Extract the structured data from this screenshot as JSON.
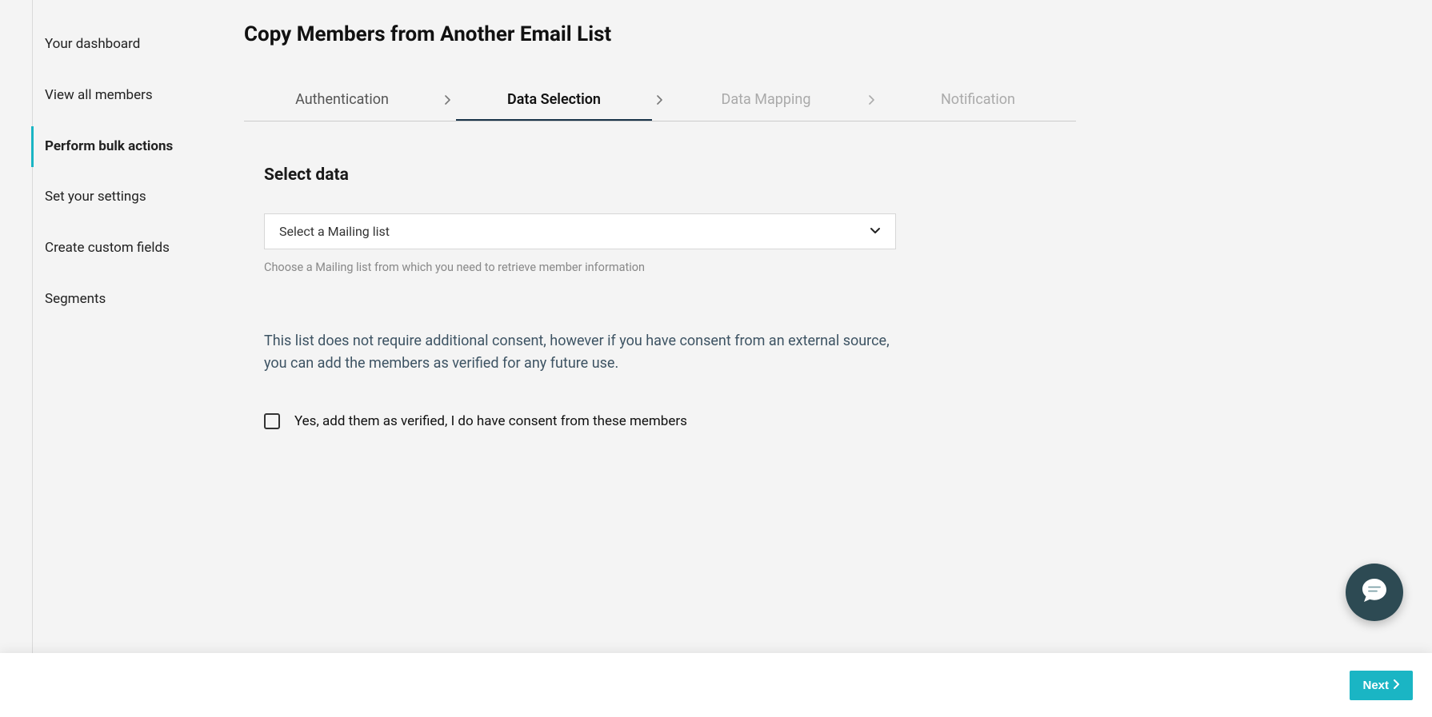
{
  "sidebar": {
    "items": [
      {
        "label": "Your dashboard",
        "active": false
      },
      {
        "label": "View all members",
        "active": false
      },
      {
        "label": "Perform bulk actions",
        "active": true
      },
      {
        "label": "Set your settings",
        "active": false
      },
      {
        "label": "Create custom fields",
        "active": false
      },
      {
        "label": "Segments",
        "active": false
      }
    ]
  },
  "header": {
    "title": "Copy Members from Another Email List"
  },
  "stepper": {
    "steps": [
      {
        "label": "Authentication",
        "state": "completed"
      },
      {
        "label": "Data Selection",
        "state": "active"
      },
      {
        "label": "Data Mapping",
        "state": "future"
      },
      {
        "label": "Notification",
        "state": "future"
      }
    ]
  },
  "section": {
    "title": "Select data",
    "select_placeholder": "Select a Mailing list",
    "select_helper": "Choose a Mailing list from which you need to retrieve member information"
  },
  "consent": {
    "text": "This list does not require additional consent, however if you have consent from an external source, you can add the members as verified for any future use.",
    "checkbox_label": "Yes, add them as verified, I do have consent from these members",
    "checked": false
  },
  "footer": {
    "next_label": "Next"
  }
}
